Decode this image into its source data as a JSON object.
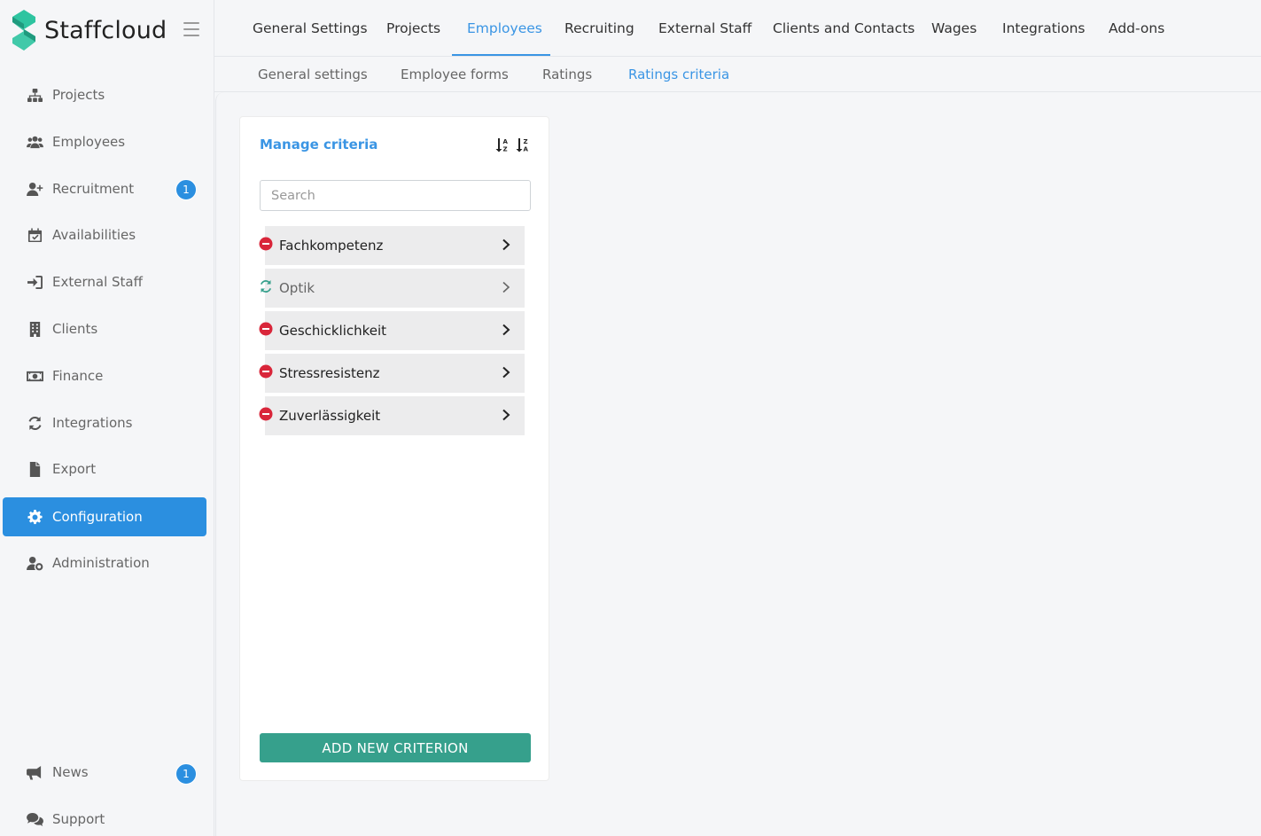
{
  "app": {
    "name": "Staffcloud"
  },
  "sidebar": {
    "items": [
      {
        "label": "Projects",
        "icon": "sitemap-icon"
      },
      {
        "label": "Employees",
        "icon": "users-icon"
      },
      {
        "label": "Recruitment",
        "icon": "user-plus-icon",
        "badge": "1"
      },
      {
        "label": "Availabilities",
        "icon": "calendar-check-icon"
      },
      {
        "label": "External Staff",
        "icon": "sign-in-icon"
      },
      {
        "label": "Clients",
        "icon": "building-icon"
      },
      {
        "label": "Finance",
        "icon": "money-icon"
      },
      {
        "label": "Integrations",
        "icon": "sync-icon"
      },
      {
        "label": "Export",
        "icon": "file-icon"
      },
      {
        "label": "Configuration",
        "icon": "gear-icon",
        "active": true
      },
      {
        "label": "Administration",
        "icon": "user-cog-icon"
      }
    ],
    "bottom": [
      {
        "label": "News",
        "icon": "megaphone-icon",
        "badge": "1"
      },
      {
        "label": "Support",
        "icon": "chat-bubbles-icon"
      }
    ]
  },
  "topnav": {
    "tabs": [
      "General Settings",
      "Projects",
      "Employees",
      "Recruiting",
      "External Staff",
      "Clients and Contacts",
      "Wages",
      "Integrations",
      "Add-ons"
    ],
    "active": "Employees"
  },
  "subnav": {
    "tabs": [
      "General settings",
      "Employee forms",
      "Ratings",
      "Ratings criteria"
    ],
    "active": "Ratings criteria"
  },
  "panel": {
    "title": "Manage criteria",
    "search_placeholder": "Search",
    "criteria": [
      {
        "label": "Fachkompetenz",
        "status": "remove"
      },
      {
        "label": "Optik",
        "status": "restore"
      },
      {
        "label": "Geschicklichkeit",
        "status": "remove"
      },
      {
        "label": "Stressresistenz",
        "status": "remove"
      },
      {
        "label": "Zuverlässigkeit",
        "status": "remove"
      }
    ],
    "add_button": "ADD NEW CRITERION"
  },
  "colors": {
    "accent": "#2b8fe0",
    "link": "#3a95e4",
    "button": "#36a08c",
    "remove": "#d9263a",
    "restore": "#36a08c",
    "logo": "#2ec4a0"
  }
}
